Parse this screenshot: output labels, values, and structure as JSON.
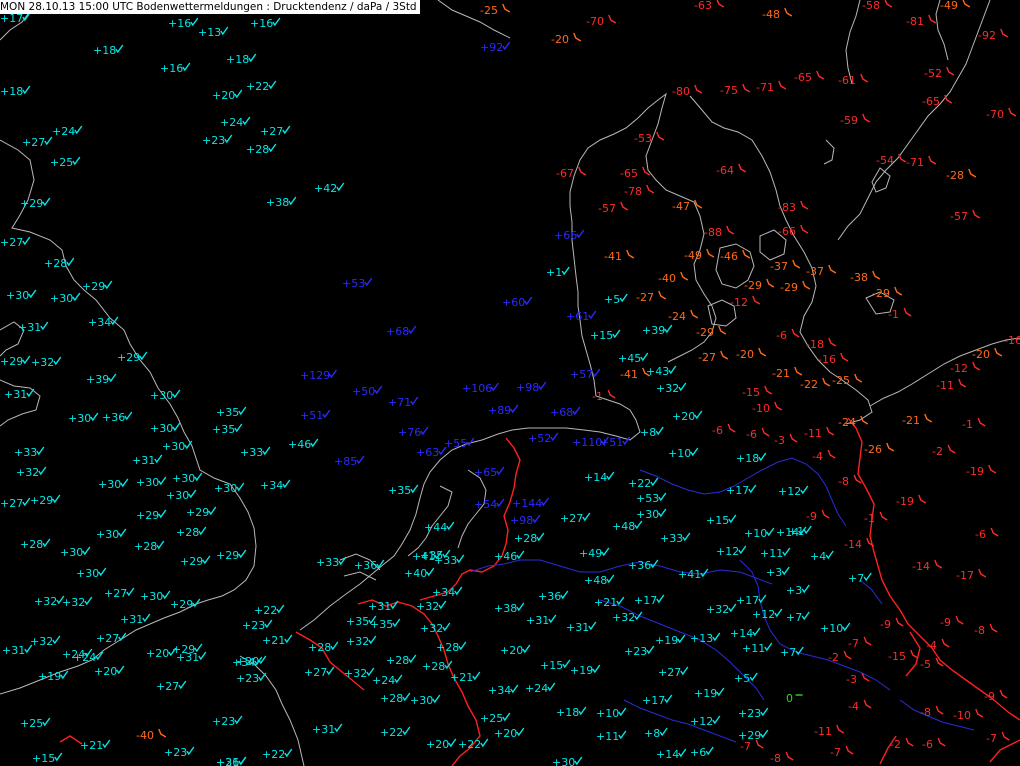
{
  "title": "MON 28.10.13 15:00 UTC  Bodenwettermeldungen :  Drucktendenz / daPa / 3Std",
  "colors": {
    "background": "#000000",
    "coast": "#b8b8b8",
    "border_red": "#ff2020",
    "border_blue": "#2b2bd8",
    "rising": "#00e8e8",
    "rising_strong": "#2a2aff",
    "falling": "#ff2a2a",
    "falling_mid": "#ff6a1a",
    "zero": "#22dd22"
  },
  "legend_note": "",
  "observations": [
    {
      "t": "+17",
      "c": "rising"
    },
    {
      "t": "+16",
      "c": "rising"
    },
    {
      "t": "+13",
      "c": "rising"
    },
    {
      "t": "+16",
      "c": "rising"
    },
    {
      "t": "+18",
      "c": "rising"
    },
    {
      "t": "+18",
      "c": "rising"
    },
    {
      "t": "+16",
      "c": "rising"
    },
    {
      "t": "+18",
      "c": "rising"
    },
    {
      "t": "+22",
      "c": "rising"
    },
    {
      "t": "+20",
      "c": "rising"
    },
    {
      "t": "+24",
      "c": "rising"
    },
    {
      "t": "+27",
      "c": "rising"
    },
    {
      "t": "+23",
      "c": "rising"
    },
    {
      "t": "+28",
      "c": "rising"
    },
    {
      "t": "+24",
      "c": "rising"
    },
    {
      "t": "+27",
      "c": "rising"
    },
    {
      "t": "+25",
      "c": "rising"
    },
    {
      "t": "+42",
      "c": "rising"
    },
    {
      "t": "+38",
      "c": "rising"
    },
    {
      "t": "+29",
      "c": "rising"
    },
    {
      "t": "+27",
      "c": "rising"
    },
    {
      "t": "+28",
      "c": "rising"
    },
    {
      "t": "+29",
      "c": "rising"
    },
    {
      "t": "+30",
      "c": "rising"
    },
    {
      "t": "+30",
      "c": "rising"
    },
    {
      "t": "+34",
      "c": "rising"
    },
    {
      "t": "+31",
      "c": "rising"
    },
    {
      "t": "+29",
      "c": "rising"
    },
    {
      "t": "+32",
      "c": "rising"
    },
    {
      "t": "+29",
      "c": "rising"
    },
    {
      "t": "+39",
      "c": "rising"
    },
    {
      "t": "+31",
      "c": "rising"
    },
    {
      "t": "+30",
      "c": "rising"
    },
    {
      "t": "+36",
      "c": "rising"
    },
    {
      "t": "+30",
      "c": "rising"
    },
    {
      "t": "+30",
      "c": "rising"
    },
    {
      "t": "+35",
      "c": "rising"
    },
    {
      "t": "+35",
      "c": "rising"
    },
    {
      "t": "+30",
      "c": "rising"
    },
    {
      "t": "+33",
      "c": "rising"
    },
    {
      "t": "+46",
      "c": "rising"
    },
    {
      "t": "+33",
      "c": "rising"
    },
    {
      "t": "+31",
      "c": "rising"
    },
    {
      "t": "+32",
      "c": "rising"
    },
    {
      "t": "+30",
      "c": "rising"
    },
    {
      "t": "+30",
      "c": "rising"
    },
    {
      "t": "+30",
      "c": "rising"
    },
    {
      "t": "+30",
      "c": "rising"
    },
    {
      "t": "+30",
      "c": "rising"
    },
    {
      "t": "+34",
      "c": "rising"
    },
    {
      "t": "+29",
      "c": "rising"
    },
    {
      "t": "+27",
      "c": "rising"
    },
    {
      "t": "+29",
      "c": "rising"
    },
    {
      "t": "+29",
      "c": "rising"
    },
    {
      "t": "+28",
      "c": "rising"
    },
    {
      "t": "+30",
      "c": "rising"
    },
    {
      "t": "+29",
      "c": "rising"
    },
    {
      "t": "+28",
      "c": "rising"
    },
    {
      "t": "+28",
      "c": "rising"
    },
    {
      "t": "+30",
      "c": "rising"
    },
    {
      "t": "+29",
      "c": "rising"
    },
    {
      "t": "+30",
      "c": "rising"
    },
    {
      "t": "+27",
      "c": "rising"
    },
    {
      "t": "+30",
      "c": "rising"
    },
    {
      "t": "+32",
      "c": "rising"
    },
    {
      "t": "+32",
      "c": "rising"
    },
    {
      "t": "+29",
      "c": "rising"
    },
    {
      "t": "+22",
      "c": "rising"
    },
    {
      "t": "+23",
      "c": "rising"
    },
    {
      "t": "+31",
      "c": "rising"
    },
    {
      "t": "+32",
      "c": "rising"
    },
    {
      "t": "+27",
      "c": "rising"
    },
    {
      "t": "+31",
      "c": "rising"
    },
    {
      "t": "+24",
      "c": "rising"
    },
    {
      "t": "+20",
      "c": "rising"
    },
    {
      "t": "+21",
      "c": "rising"
    },
    {
      "t": "+29",
      "c": "rising"
    },
    {
      "t": "+34",
      "c": "rising"
    },
    {
      "t": "+24",
      "c": "rising"
    },
    {
      "t": "+31",
      "c": "rising"
    },
    {
      "t": "+20",
      "c": "rising"
    },
    {
      "t": "+23",
      "c": "rising"
    },
    {
      "t": "+20",
      "c": "rising"
    },
    {
      "t": "+19",
      "c": "rising"
    },
    {
      "t": "+27",
      "c": "rising"
    },
    {
      "t": "+23",
      "c": "rising"
    },
    {
      "t": "+25",
      "c": "rising"
    },
    {
      "t": "+21",
      "c": "rising"
    },
    {
      "t": "+15",
      "c": "rising"
    },
    {
      "t": "+23",
      "c": "rising"
    },
    {
      "t": "+26",
      "c": "rising"
    },
    {
      "t": "+22",
      "c": "rising"
    },
    {
      "t": "+31",
      "c": "rising"
    },
    {
      "t": "+33",
      "c": "rising"
    },
    {
      "t": "+36",
      "c": "rising"
    },
    {
      "t": "+41",
      "c": "rising"
    },
    {
      "t": "+35",
      "c": "rising"
    },
    {
      "t": "+33",
      "c": "rising"
    },
    {
      "t": "+40",
      "c": "rising"
    },
    {
      "t": "+44",
      "c": "rising"
    },
    {
      "t": "+35",
      "c": "rising"
    },
    {
      "t": "+34",
      "c": "rising"
    },
    {
      "t": "+32",
      "c": "rising"
    },
    {
      "t": "+31",
      "c": "rising"
    },
    {
      "t": "+35",
      "c": "rising"
    },
    {
      "t": "+32",
      "c": "rising"
    },
    {
      "t": "+35",
      "c": "rising"
    },
    {
      "t": "+28",
      "c": "rising"
    },
    {
      "t": "+28",
      "c": "rising"
    },
    {
      "t": "+27",
      "c": "rising"
    },
    {
      "t": "+32",
      "c": "rising"
    },
    {
      "t": "+28",
      "c": "rising"
    },
    {
      "t": "+32",
      "c": "rising"
    },
    {
      "t": "+24",
      "c": "rising"
    },
    {
      "t": "+28",
      "c": "rising"
    },
    {
      "t": "+30",
      "c": "rising"
    },
    {
      "t": "+28",
      "c": "rising"
    },
    {
      "t": "+21",
      "c": "rising"
    },
    {
      "t": "+22",
      "c": "rising"
    },
    {
      "t": "+20",
      "c": "rising"
    },
    {
      "t": "+22",
      "c": "rising"
    },
    {
      "t": "+25",
      "c": "rising"
    },
    {
      "t": "+34",
      "c": "rising"
    },
    {
      "t": "+24",
      "c": "rising"
    },
    {
      "t": "+20",
      "c": "rising"
    },
    {
      "t": "+15",
      "c": "rising"
    },
    {
      "t": "+19",
      "c": "rising"
    },
    {
      "t": "+18",
      "c": "rising"
    },
    {
      "t": "+20",
      "c": "rising"
    },
    {
      "t": "+31",
      "c": "rising"
    },
    {
      "t": "+30",
      "c": "rising"
    },
    {
      "t": "+38",
      "c": "rising"
    },
    {
      "t": "+31",
      "c": "rising"
    },
    {
      "t": "+36",
      "c": "rising"
    },
    {
      "t": "+31",
      "c": "rising"
    },
    {
      "t": "+32",
      "c": "rising"
    },
    {
      "t": "+21",
      "c": "rising"
    },
    {
      "t": "+17",
      "c": "rising"
    },
    {
      "t": "+23",
      "c": "rising"
    },
    {
      "t": "+19",
      "c": "rising"
    },
    {
      "t": "+17",
      "c": "rising"
    },
    {
      "t": "+11",
      "c": "rising"
    },
    {
      "t": "+8",
      "c": "rising"
    },
    {
      "t": "+14",
      "c": "rising"
    },
    {
      "t": "+6",
      "c": "rising"
    },
    {
      "t": "+10",
      "c": "rising"
    },
    {
      "t": "+13",
      "c": "rising"
    },
    {
      "t": "+27",
      "c": "rising"
    },
    {
      "t": "+19",
      "c": "rising"
    },
    {
      "t": "+14",
      "c": "rising"
    },
    {
      "t": "+12",
      "c": "rising"
    },
    {
      "t": "+17",
      "c": "rising"
    },
    {
      "t": "+12",
      "c": "rising"
    },
    {
      "t": "+11",
      "c": "rising"
    },
    {
      "t": "+7",
      "c": "rising"
    },
    {
      "t": "+7",
      "c": "rising"
    },
    {
      "t": "+5",
      "c": "rising"
    },
    {
      "t": "+10",
      "c": "rising"
    },
    {
      "t": "+23",
      "c": "rising"
    },
    {
      "t": "+29",
      "c": "rising"
    },
    {
      "t": "+32",
      "c": "rising"
    },
    {
      "t": "+41",
      "c": "rising"
    },
    {
      "t": "+36",
      "c": "rising"
    },
    {
      "t": "+49",
      "c": "rising"
    },
    {
      "t": "+48",
      "c": "rising"
    },
    {
      "t": "+46",
      "c": "rising"
    },
    {
      "t": "+48",
      "c": "rising"
    },
    {
      "t": "+27",
      "c": "rising"
    },
    {
      "t": "+28",
      "c": "rising"
    },
    {
      "t": "+30",
      "c": "rising"
    },
    {
      "t": "+33",
      "c": "rising"
    },
    {
      "t": "+53",
      "c": "rising"
    },
    {
      "t": "+22",
      "c": "rising"
    },
    {
      "t": "+14",
      "c": "rising"
    },
    {
      "t": "+15",
      "c": "rising"
    },
    {
      "t": "+10",
      "c": "rising"
    },
    {
      "t": "+17",
      "c": "rising"
    },
    {
      "t": "+10",
      "c": "rising"
    },
    {
      "t": "+12",
      "c": "rising"
    },
    {
      "t": "+11",
      "c": "rising"
    },
    {
      "t": "+3",
      "c": "rising"
    },
    {
      "t": "+3",
      "c": "rising"
    },
    {
      "t": "+1",
      "c": "rising"
    },
    {
      "t": "+4",
      "c": "rising"
    },
    {
      "t": "+7",
      "c": "rising"
    },
    {
      "t": "+14",
      "c": "rising"
    },
    {
      "t": "+12",
      "c": "rising"
    },
    {
      "t": "+18",
      "c": "rising"
    },
    {
      "t": "+20",
      "c": "rising"
    },
    {
      "t": "+32",
      "c": "rising"
    },
    {
      "t": "+43",
      "c": "rising"
    },
    {
      "t": "+45",
      "c": "rising"
    },
    {
      "t": "+8",
      "c": "rising"
    },
    {
      "t": "+15",
      "c": "rising"
    },
    {
      "t": "+39",
      "c": "rising"
    },
    {
      "t": "+5",
      "c": "rising"
    },
    {
      "t": "+1",
      "c": "rising"
    },
    {
      "t": "+66",
      "c": "rising_strong"
    },
    {
      "t": "+92",
      "c": "rising_strong"
    },
    {
      "t": "+53",
      "c": "rising_strong"
    },
    {
      "t": "+68",
      "c": "rising_strong"
    },
    {
      "t": "+129",
      "c": "rising_strong"
    },
    {
      "t": "+50",
      "c": "rising_strong"
    },
    {
      "t": "+71",
      "c": "rising_strong"
    },
    {
      "t": "+51",
      "c": "rising_strong"
    },
    {
      "t": "+76",
      "c": "rising_strong"
    },
    {
      "t": "+85",
      "c": "rising_strong"
    },
    {
      "t": "+63",
      "c": "rising_strong"
    },
    {
      "t": "+55",
      "c": "rising_strong"
    },
    {
      "t": "+65",
      "c": "rising_strong"
    },
    {
      "t": "+54",
      "c": "rising_strong"
    },
    {
      "t": "+144",
      "c": "rising_strong"
    },
    {
      "t": "+98",
      "c": "rising_strong"
    },
    {
      "t": "+106",
      "c": "rising_strong"
    },
    {
      "t": "+98",
      "c": "rising_strong"
    },
    {
      "t": "+89",
      "c": "rising_strong"
    },
    {
      "t": "+68",
      "c": "rising_strong"
    },
    {
      "t": "+52",
      "c": "rising_strong"
    },
    {
      "t": "+110",
      "c": "rising_strong"
    },
    {
      "t": "+51",
      "c": "rising_strong"
    },
    {
      "t": "+60",
      "c": "rising_strong"
    },
    {
      "t": "+61",
      "c": "rising_strong"
    },
    {
      "t": "+57",
      "c": "rising_strong"
    },
    {
      "t": "-1",
      "c": "falling"
    },
    {
      "t": "-40",
      "c": "falling"
    },
    {
      "t": "-25",
      "c": "falling"
    },
    {
      "t": "-70",
      "c": "falling"
    },
    {
      "t": "-20",
      "c": "falling"
    },
    {
      "t": "-63",
      "c": "falling"
    },
    {
      "t": "-48",
      "c": "falling"
    },
    {
      "t": "-58",
      "c": "falling"
    },
    {
      "t": "-49",
      "c": "falling"
    },
    {
      "t": "-81",
      "c": "falling"
    },
    {
      "t": "-92",
      "c": "falling"
    },
    {
      "t": "-80",
      "c": "falling"
    },
    {
      "t": "-75",
      "c": "falling"
    },
    {
      "t": "-71",
      "c": "falling"
    },
    {
      "t": "-65",
      "c": "falling"
    },
    {
      "t": "-61",
      "c": "falling"
    },
    {
      "t": "-59",
      "c": "falling"
    },
    {
      "t": "-65",
      "c": "falling"
    },
    {
      "t": "-70",
      "c": "falling"
    },
    {
      "t": "-52",
      "c": "falling"
    },
    {
      "t": "-53",
      "c": "falling"
    },
    {
      "t": "-54",
      "c": "falling"
    },
    {
      "t": "-71",
      "c": "falling"
    },
    {
      "t": "-28",
      "c": "falling"
    },
    {
      "t": "-64",
      "c": "falling"
    },
    {
      "t": "-67",
      "c": "falling"
    },
    {
      "t": "-65",
      "c": "falling"
    },
    {
      "t": "-78",
      "c": "falling"
    },
    {
      "t": "-57",
      "c": "falling"
    },
    {
      "t": "-47",
      "c": "falling"
    },
    {
      "t": "-83",
      "c": "falling"
    },
    {
      "t": "-57",
      "c": "falling"
    },
    {
      "t": "-88",
      "c": "falling"
    },
    {
      "t": "-66",
      "c": "falling"
    },
    {
      "t": "-49",
      "c": "falling"
    },
    {
      "t": "-46",
      "c": "falling"
    },
    {
      "t": "-41",
      "c": "falling"
    },
    {
      "t": "-40",
      "c": "falling"
    },
    {
      "t": "-37",
      "c": "falling"
    },
    {
      "t": "-37",
      "c": "falling"
    },
    {
      "t": "-38",
      "c": "falling"
    },
    {
      "t": "-29",
      "c": "falling"
    },
    {
      "t": "-29",
      "c": "falling"
    },
    {
      "t": "-29",
      "c": "falling"
    },
    {
      "t": "-27",
      "c": "falling"
    },
    {
      "t": "-12",
      "c": "falling"
    },
    {
      "t": "-1",
      "c": "falling"
    },
    {
      "t": "-24",
      "c": "falling"
    },
    {
      "t": "-29",
      "c": "falling"
    },
    {
      "t": "-6",
      "c": "falling"
    },
    {
      "t": "-18",
      "c": "falling"
    },
    {
      "t": "-27",
      "c": "falling"
    },
    {
      "t": "-41",
      "c": "falling"
    },
    {
      "t": "-20",
      "c": "falling"
    },
    {
      "t": "-16",
      "c": "falling"
    },
    {
      "t": "-21",
      "c": "falling"
    },
    {
      "t": "-22",
      "c": "falling"
    },
    {
      "t": "-25",
      "c": "falling"
    },
    {
      "t": "-20",
      "c": "falling"
    },
    {
      "t": "-16",
      "c": "falling"
    },
    {
      "t": "-12",
      "c": "falling"
    },
    {
      "t": "-11",
      "c": "falling"
    },
    {
      "t": "-15",
      "c": "falling"
    },
    {
      "t": "-10",
      "c": "falling"
    },
    {
      "t": "-24",
      "c": "falling"
    },
    {
      "t": "-21",
      "c": "falling"
    },
    {
      "t": "-1",
      "c": "falling"
    },
    {
      "t": "-2",
      "c": "falling"
    },
    {
      "t": "-6",
      "c": "falling"
    },
    {
      "t": "-3",
      "c": "falling"
    },
    {
      "t": "-11",
      "c": "falling"
    },
    {
      "t": "-4",
      "c": "falling"
    },
    {
      "t": "-26",
      "c": "falling"
    },
    {
      "t": "-19",
      "c": "falling"
    },
    {
      "t": "-8",
      "c": "falling"
    },
    {
      "t": "-19",
      "c": "falling"
    },
    {
      "t": "-1",
      "c": "falling"
    },
    {
      "t": "-6",
      "c": "falling"
    },
    {
      "t": "-14",
      "c": "falling"
    },
    {
      "t": "-14",
      "c": "falling"
    },
    {
      "t": "-17",
      "c": "falling"
    },
    {
      "t": "-9",
      "c": "falling"
    },
    {
      "t": "-8",
      "c": "falling"
    },
    {
      "t": "-9",
      "c": "falling"
    },
    {
      "t": "-7",
      "c": "falling"
    },
    {
      "t": "-15",
      "c": "falling"
    },
    {
      "t": "-4",
      "c": "falling"
    },
    {
      "t": "-5",
      "c": "falling"
    },
    {
      "t": "-2",
      "c": "falling"
    },
    {
      "t": "-3",
      "c": "falling"
    },
    {
      "t": "-4",
      "c": "falling"
    },
    {
      "t": "-8",
      "c": "falling"
    },
    {
      "t": "-10",
      "c": "falling"
    },
    {
      "t": "-9",
      "c": "falling"
    },
    {
      "t": "-11",
      "c": "falling"
    },
    {
      "t": "-2",
      "c": "falling"
    },
    {
      "t": "-6",
      "c": "falling"
    },
    {
      "t": "-7",
      "c": "falling"
    },
    {
      "t": "-8",
      "c": "falling"
    },
    {
      "t": "-7",
      "c": "falling"
    },
    {
      "t": "-7",
      "c": "falling"
    },
    {
      "t": "-6",
      "c": "falling"
    },
    {
      "t": "-9",
      "c": "falling"
    },
    {
      "t": "0",
      "c": "zero"
    },
    {
      "t": "0",
      "c": "zero"
    },
    {
      "t": "0",
      "c": "zero"
    }
  ]
}
